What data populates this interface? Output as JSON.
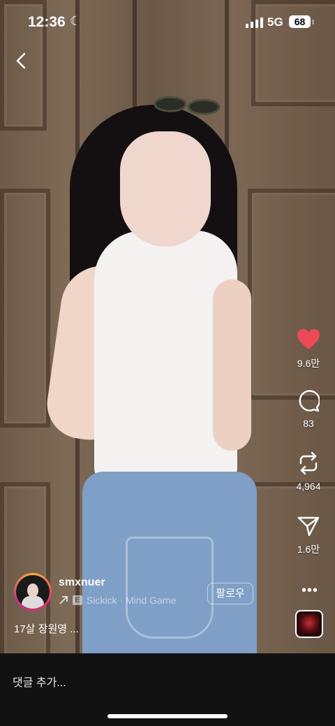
{
  "status_bar": {
    "time": "12:36",
    "network": "5G",
    "battery": "68"
  },
  "actions": {
    "likes": "9.6만",
    "comments": "83",
    "reposts": "4,964",
    "shares": "1.6만"
  },
  "post": {
    "username": "smxnuer",
    "music_badge": "E",
    "music": "Sickick · Mind Game",
    "follow_label": "팔로우",
    "caption": "17살 장원영 ..."
  },
  "comment_bar": {
    "placeholder": "댓글 추가..."
  },
  "colors": {
    "like": "#ed4956",
    "background": "#121212"
  },
  "icons": [
    "back-icon",
    "heart-icon",
    "comment-icon",
    "repost-icon",
    "share-icon",
    "more-icon",
    "music-icon"
  ]
}
